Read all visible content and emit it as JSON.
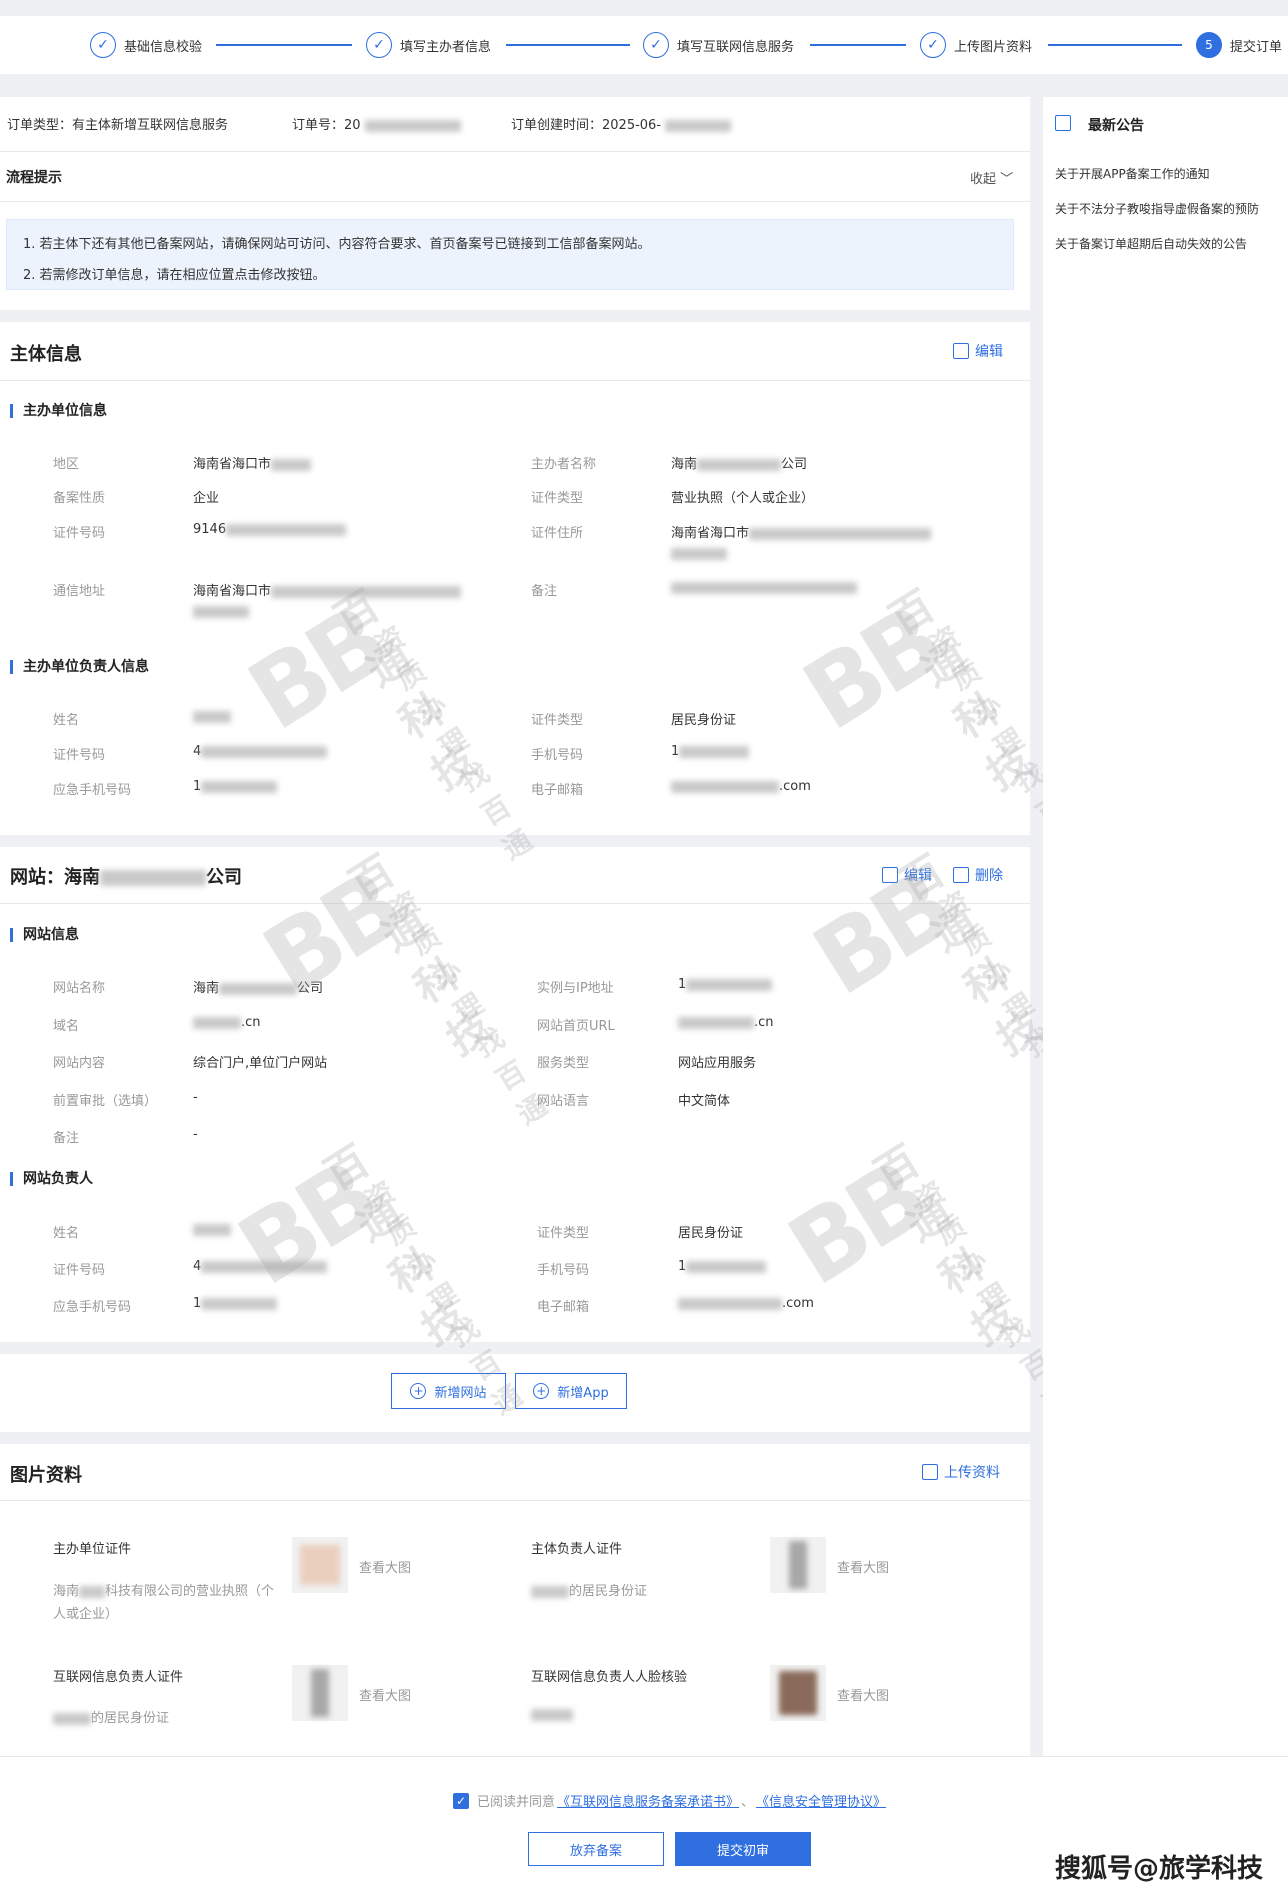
{
  "steps": [
    {
      "label": "基础信息校验",
      "mark": "✓"
    },
    {
      "label": "填写主办者信息",
      "mark": "✓"
    },
    {
      "label": "填写互联网信息服务",
      "mark": "✓"
    },
    {
      "label": "上传图片资料",
      "mark": "✓"
    },
    {
      "label": "提交订单",
      "mark": "5"
    }
  ],
  "order": {
    "type": "订单类型：有主体新增互联网信息服务",
    "number_prefix": "订单号：20",
    "created_prefix": "订单创建时间：2025-06-"
  },
  "process": {
    "title": "流程提示",
    "collapse": "收起",
    "tips": [
      "1. 若主体下还有其他已备案网站，请确保网站可访问、内容符合要求、首页备案号已链接到工信部备案网站。",
      "2. 若需修改订单信息，请在相应位置点击修改按钮。"
    ]
  },
  "subject": {
    "title": "主体信息",
    "edit": "编辑",
    "org_title": "主办单位信息",
    "org": {
      "region_k": "地区",
      "region_v": "海南省海口市",
      "name_k": "主办者名称",
      "name_v_prefix": "海南",
      "name_v_suffix": "公司",
      "nature_k": "备案性质",
      "nature_v": "企业",
      "certtype_k": "证件类型",
      "certtype_v": "营业执照（个人或企业）",
      "certno_k": "证件号码",
      "certno_v": "9146",
      "certaddr_k": "证件住所",
      "certaddr_v": "海南省海口市",
      "mail_k": "通信地址",
      "mail_v": "海南省海口市",
      "remark_k": "备注"
    },
    "person_title": "主办单位负责人信息",
    "person": {
      "name_k": "姓名",
      "certtype_k": "证件类型",
      "certtype_v": "居民身份证",
      "certno_k": "证件号码",
      "certno_v": "4",
      "phone_k": "手机号码",
      "phone_v": "1",
      "emergency_k": "应急手机号码",
      "emergency_v": "1",
      "email_k": "电子邮箱",
      "email_v": ".com"
    }
  },
  "website": {
    "title_prefix": "网站：海南",
    "title_suffix": "公司",
    "edit": "编辑",
    "delete": "删除",
    "info_title": "网站信息",
    "info": {
      "name_k": "网站名称",
      "name_v_prefix": "海南",
      "name_v_suffix": "公司",
      "ip_k": "实例与IP地址",
      "ip_v": "1",
      "domain_k": "域名",
      "domain_v": ".cn",
      "url_k": "网站首页URL",
      "url_v": ".cn",
      "content_k": "网站内容",
      "content_v": "综合门户,单位门户网站",
      "service_k": "服务类型",
      "service_v": "网站应用服务",
      "pre_k": "前置审批（选填）",
      "pre_v": "-",
      "lang_k": "网站语言",
      "lang_v": "中文简体",
      "remark_k": "备注",
      "remark_v": "-"
    },
    "owner_title": "网站负责人",
    "owner": {
      "name_k": "姓名",
      "certtype_k": "证件类型",
      "certtype_v": "居民身份证",
      "certno_k": "证件号码",
      "certno_v": "4",
      "phone_k": "手机号码",
      "phone_v": "1",
      "emergency_k": "应急手机号码",
      "emergency_v": "1",
      "email_k": "电子邮箱",
      "email_v": ".com"
    },
    "add_site": "新增网站",
    "add_app": "新增App"
  },
  "images": {
    "title": "图片资料",
    "upload": "上传资料",
    "view": "查看大图",
    "items": [
      {
        "title": "主办单位证件",
        "desc1": "海南",
        "desc2": "科技有限公司的营业执照（个",
        "desc3": "人或企业）"
      },
      {
        "title": "主体负责人证件",
        "desc": "的居民身份证"
      },
      {
        "title": "互联网信息负责人证件",
        "desc": "的居民身份证"
      },
      {
        "title": "互联网信息负责人人脸核验",
        "desc": ""
      }
    ]
  },
  "notices": {
    "title": "最新公告",
    "items": [
      "关于开展APP备案工作的通知",
      "关于不法分子教唆指导虚假备案的预防",
      "关于备案订单超期后自动失效的公告"
    ]
  },
  "footer": {
    "agree_prefix": "已阅读并同意",
    "doc1": "《互联网信息服务备案承诺书》",
    "sep": "、",
    "doc2": "《信息安全管理协议》",
    "cancel": "放弃备案",
    "submit": "提交初审"
  },
  "watermark": {
    "logo": "BB",
    "line1": "百通科技",
    "line2": "资质办理找百通"
  },
  "credit": "搜狐号@旅学科技",
  "colors": {
    "accent": "#2f6fe0",
    "notice_bg": "#edf3fd"
  }
}
